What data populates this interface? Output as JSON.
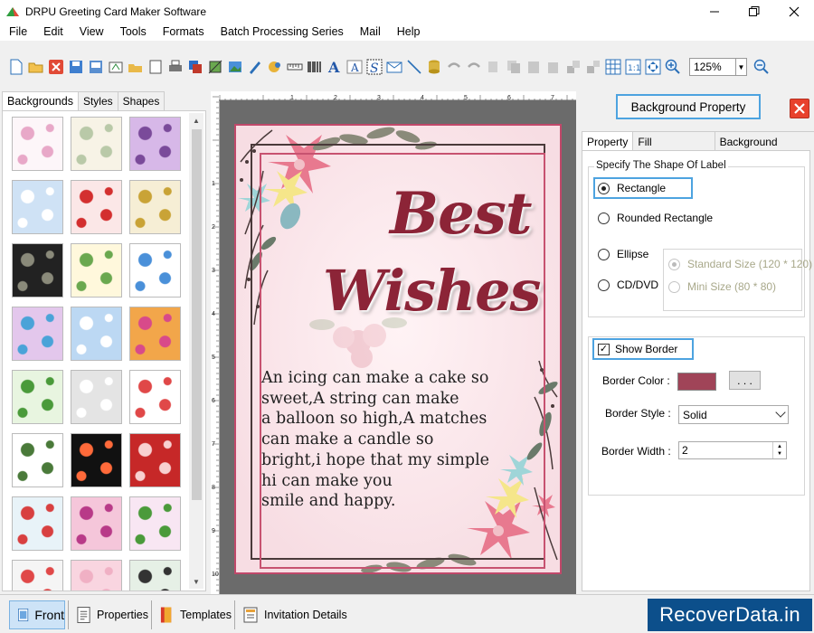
{
  "window": {
    "title": "DRPU Greeting Card Maker Software"
  },
  "menu": [
    "File",
    "Edit",
    "View",
    "Tools",
    "Formats",
    "Batch Processing Series",
    "Mail",
    "Help"
  ],
  "toolbar": {
    "zoom": "125%"
  },
  "left_tabs": [
    "Backgrounds",
    "Styles",
    "Shapes"
  ],
  "card": {
    "heading1": "Best",
    "heading2": "Wishes",
    "message": "An icing can make a cake so\nsweet,A string can make\na balloon so high,A matches\ncan make a candle so\nbright,i hope that my simple\nhi can make you\nsmile and happy."
  },
  "ruler": {
    "marks": [
      "1",
      "2",
      "3",
      "4",
      "5",
      "6",
      "7"
    ],
    "left_marks": [
      "1",
      "2",
      "3",
      "4",
      "5",
      "6",
      "7",
      "8",
      "9",
      "10"
    ]
  },
  "right": {
    "header": "Background Property",
    "tabs": [
      "Property",
      "Fill Background",
      "Background Effects"
    ],
    "shape_group": "Specify The Shape Of Label",
    "shapes": {
      "rectangle": "Rectangle",
      "rounded": "Rounded Rectangle",
      "ellipse": "Ellipse",
      "cddvd": "CD/DVD"
    },
    "sizes": {
      "standard": "Standard Size (120 * 120)",
      "mini": "Mini Size (80 * 80)"
    },
    "show_border": "Show Border",
    "border_color_label": "Border Color :",
    "border_color_value": "#a04458",
    "dots_button": ". . .",
    "border_style_label": "Border Style :",
    "border_style_value": "Solid",
    "border_width_label": "Border Width :",
    "border_width_value": "2"
  },
  "bottom_tabs": [
    "Front",
    "Properties",
    "Templates",
    "Invitation Details"
  ],
  "brand": "RecoverData.in"
}
